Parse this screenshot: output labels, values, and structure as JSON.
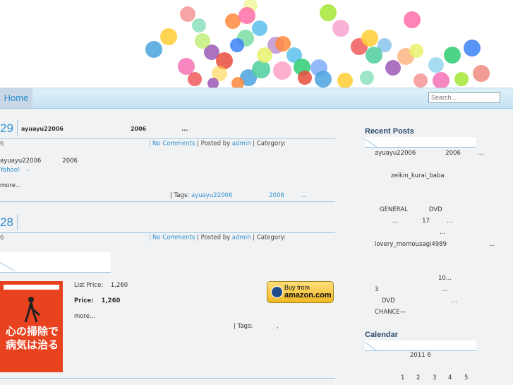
{
  "header": {
    "dot_colors": [
      "#f05a5a",
      "#ffcc33",
      "#4aa3df",
      "#4ecf9b",
      "#9b59b6",
      "#ff8a3d",
      "#e8f26b",
      "#fd6ea7",
      "#5bc0eb",
      "#2ecc71",
      "#3b82f6",
      "#e74c3c",
      "#a3e635",
      "#f472b6"
    ]
  },
  "nav": {
    "home_label": "Home",
    "search_placeholder": "Search..."
  },
  "posts": [
    {
      "day": "29",
      "day_sub": "6",
      "title_a": "ayuayu22006",
      "title_b": "2006",
      "title_c": "...",
      "comments": "No Comments",
      "posted_by": "Posted by",
      "author": "admin",
      "category_label": "Category:",
      "body_a": "ayuayu22006",
      "body_b": "2006",
      "body_link_a": "Yahoo!",
      "body_link_b": "–",
      "more": "more...",
      "tags_label": "| Tags:",
      "tag_a": "ayuayu22006",
      "tag_b": "2006",
      "tag_c": "..."
    },
    {
      "day": "28",
      "day_sub": "6",
      "comments": "No Comments",
      "posted_by": "Posted by",
      "author": "admin",
      "category_label": "Category:",
      "book_title": "心の掃除で病気は治る",
      "list_price_label": "List Price:",
      "list_price": "1,260",
      "price_label": "Price:",
      "price": "1,260",
      "more": "more...",
      "tags_label": "| Tags:",
      "tag_sep": ",",
      "amazon_l1": "Buy from",
      "amazon_l2": "amazon.com"
    }
  ],
  "sidebar": {
    "recent_title": "Recent Posts",
    "recent": {
      "r1a": "ayuayu22006",
      "r1b": "2006",
      "r1c": "...",
      "r2": "zeikin_kurai_baba",
      "r3a": "GENERAL",
      "r3b": "DVD",
      "r4a": "...",
      "r4b": "17",
      "r4c": "...",
      "r5": "...",
      "r6a": "lovery_momousagi4989",
      "r6b": "...",
      "r7": "10...",
      "r8a": "3",
      "r8b": "...",
      "r9a": "DVD",
      "r9b": "...",
      "r10": "CHANCE—"
    },
    "calendar_title": "Calendar",
    "calendar_month": "2011 6",
    "calendar_days": [
      "1",
      "2",
      "3",
      "4",
      "5"
    ]
  }
}
